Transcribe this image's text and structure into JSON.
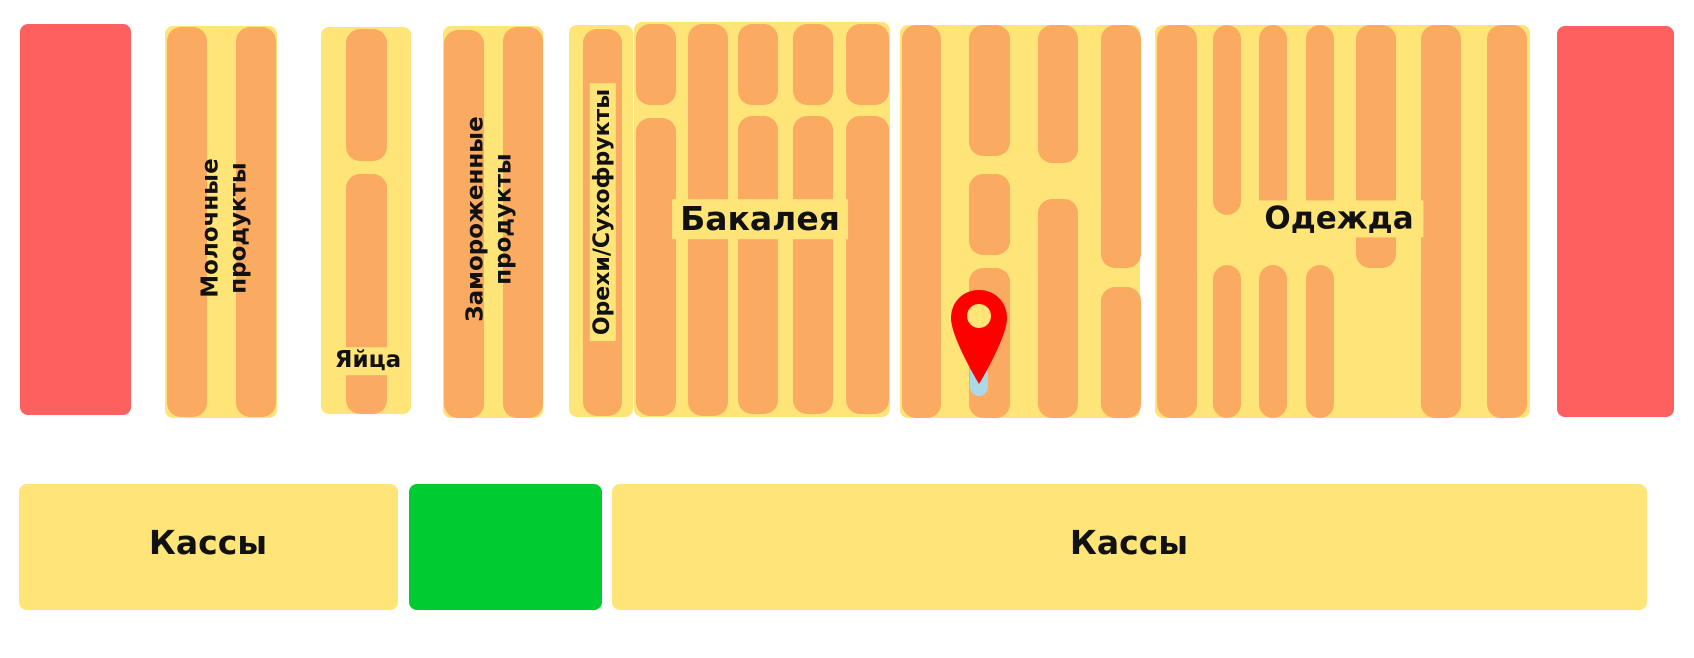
{
  "sections": {
    "dairy": "Молочные\nпродукты",
    "eggs": "Яйца",
    "frozen": "Замороженные\nпродукты",
    "nuts": "Орехи/Сухофрукты",
    "grocery": "Бакалея",
    "clothing": "Одежда"
  },
  "checkout": {
    "left_label": "Кассы",
    "right_label": "Кассы"
  },
  "colors": {
    "restricted": "#fe6060",
    "aisle_area": "#ffe477",
    "shelf": "#fbaa62",
    "entrance": "#00cb31",
    "marker": "#ff0000"
  },
  "marker": {
    "icon": "location-pin-icon"
  }
}
